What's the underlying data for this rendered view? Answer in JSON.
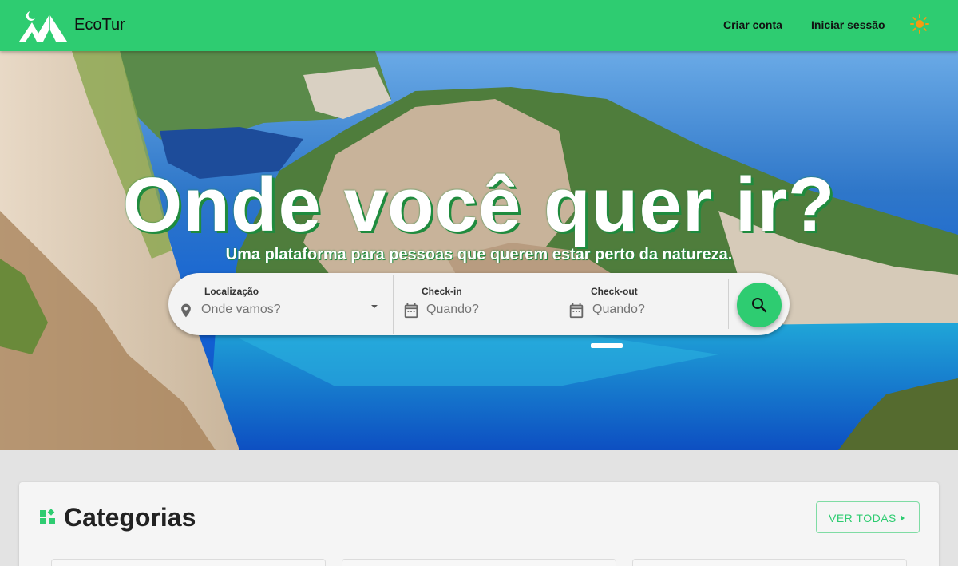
{
  "header": {
    "brand": "EcoTur",
    "nav": {
      "signup": "Criar conta",
      "login": "Iniciar sessão"
    },
    "icons": {
      "logo": "tent-moon-logo",
      "theme": "sun-icon"
    },
    "colors": {
      "bar": "#2ecc71",
      "sun": "#f39c12"
    }
  },
  "hero": {
    "title": "Onde você quer ir?",
    "subtitle": "Uma plataforma para pessoas que querem estar perto da natureza."
  },
  "search": {
    "location": {
      "label": "Localização",
      "placeholder": "Onde vamos?",
      "icon": "location-pin-icon"
    },
    "checkin": {
      "label": "Check-in",
      "placeholder": "Quando?",
      "icon": "calendar-icon"
    },
    "checkout": {
      "label": "Check-out",
      "placeholder": "Quando?",
      "icon": "calendar-icon"
    },
    "button_icon": "search-icon"
  },
  "categories": {
    "title": "Categorias",
    "see_all": "VER TODAS",
    "icon": "widgets-icon"
  }
}
